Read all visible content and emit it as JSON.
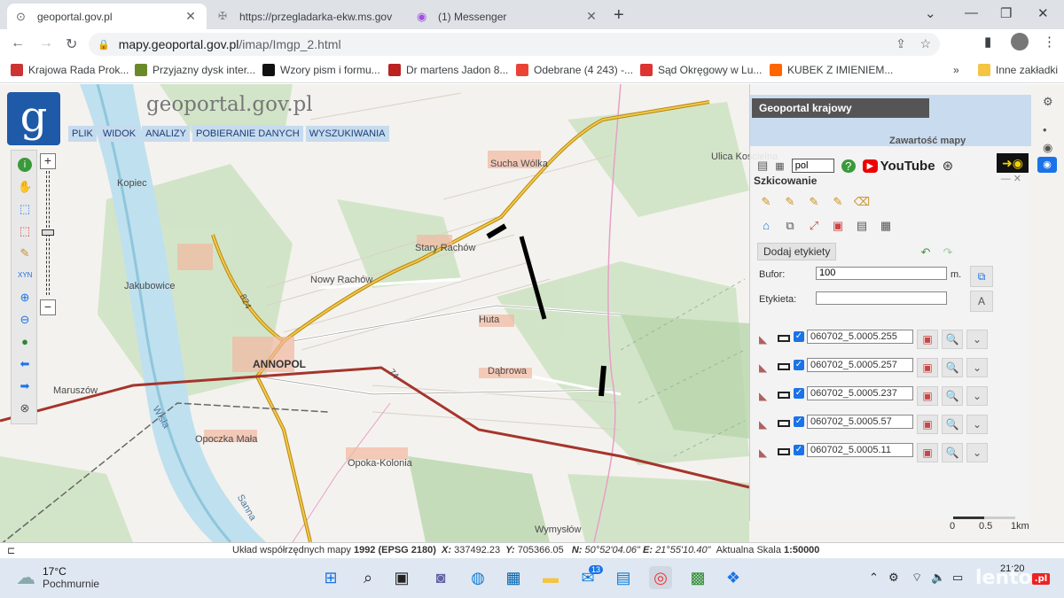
{
  "browser": {
    "tabs": [
      {
        "title": "geoportal.gov.pl",
        "active": true
      },
      {
        "title": "https://przegladarka-ekw.ms.gov",
        "active": false
      },
      {
        "title": "(1) Messenger",
        "active": false
      }
    ],
    "address_domain": "mapy.geoportal.gov.pl",
    "address_path": "/imap/Imgp_2.html",
    "bookmarks": [
      "Krajowa Rada Prok...",
      "Przyjazny dysk inter...",
      "Wzory pism i formu...",
      "Dr martens Jadon 8...",
      "Odebrane (4 243) -...",
      "Sąd Okręgowy w Lu...",
      "KUBEK Z IMIENIEM...",
      "»",
      "Inne zakładki"
    ]
  },
  "app": {
    "logo_letter": "g",
    "logo_text": "geoportal.gov.pl",
    "menu": [
      "PLIK",
      "WIDOK",
      "ANALIZY",
      "POBIERANIE DANYCH",
      "WYSZUKIWANIA"
    ]
  },
  "map": {
    "places": [
      {
        "name": "Sucha Wólka",
        "big": false
      },
      {
        "name": "Ulica Kościelna",
        "big": false
      },
      {
        "name": "Kopiec",
        "big": false
      },
      {
        "name": "Stary Rachów",
        "big": false
      },
      {
        "name": "Nowy Rachów",
        "big": false
      },
      {
        "name": "Jakubowice",
        "big": false
      },
      {
        "name": "Huta",
        "big": false
      },
      {
        "name": "ANNOPOL",
        "big": true
      },
      {
        "name": "Dąbrowa",
        "big": false
      },
      {
        "name": "Maruszów",
        "big": false
      },
      {
        "name": "Opoczka Mała",
        "big": false
      },
      {
        "name": "Opoka-Kolonia",
        "big": false
      },
      {
        "name": "Wymysłów",
        "big": false
      },
      {
        "name": "Wisła",
        "big": false
      },
      {
        "name": "Sanna",
        "big": false
      }
    ],
    "road_labels": [
      "824",
      "74"
    ]
  },
  "panel": {
    "top_title": "Geoportal krajowy",
    "contents_label": "Zawartość mapy",
    "language": "pol",
    "youtube_label": "YouTube",
    "section_title": "Szkicowanie",
    "add_labels_button": "Dodaj etykiety",
    "bufor_label": "Bufor:",
    "bufor_value": "100",
    "bufor_unit": "m.",
    "etykieta_label": "Etykieta:",
    "etykieta_value": "",
    "parcels": [
      "060702_5.0005.255",
      "060702_5.0005.257",
      "060702_5.0005.237",
      "060702_5.0005.57",
      "060702_5.0005.11"
    ],
    "scale_labels": [
      "0",
      "0.5",
      "1km"
    ]
  },
  "status": {
    "text_prefix": "Układ współrzędnych mapy",
    "crs": "1992 (EPSG 2180)",
    "x_label": "X:",
    "x_value": "337492.23",
    "y_label": "Y:",
    "y_value": "705366.05",
    "n_label": "N:",
    "n_value": "50°52'04.06\"",
    "e_label": "E:",
    "e_value": "21°55'10.40\"",
    "scale_label": "Aktualna Skala",
    "scale_value": "1:50000"
  },
  "taskbar": {
    "temp": "17°C",
    "weather": "Pochmurnie",
    "clock_time": "21:20",
    "mail_badge": "13"
  },
  "watermark": {
    "text": "lento",
    "suffix": ".pl"
  }
}
